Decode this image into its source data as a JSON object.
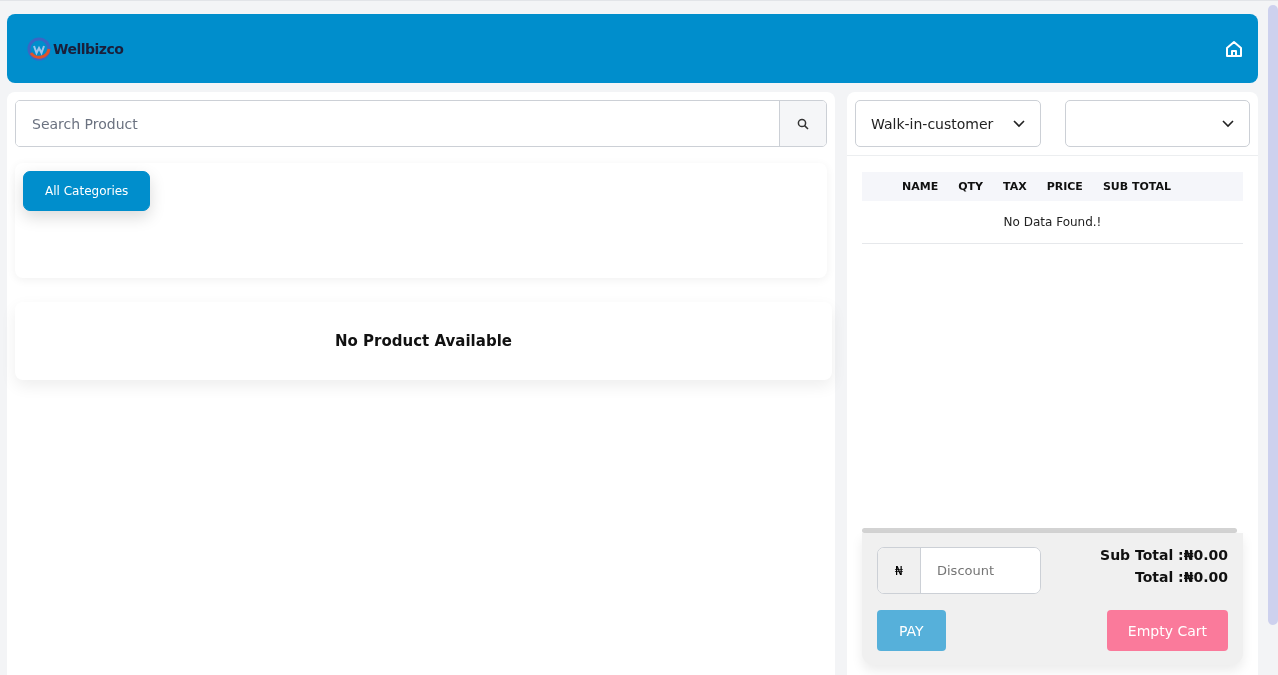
{
  "header": {
    "logo_text": "Wellbizco"
  },
  "search": {
    "placeholder": "Search Product"
  },
  "categories": [
    {
      "label": "All Categories",
      "selected": true
    }
  ],
  "products": {
    "empty_message": "No Product Available"
  },
  "cart": {
    "customer_select": {
      "value": "Walk-in-customer"
    },
    "columns": [
      "NAME",
      "QTY",
      "TAX",
      "PRICE",
      "SUB TOTAL"
    ],
    "empty_message": "No Data Found.!",
    "discount": {
      "currency": "₦",
      "placeholder": "Discount"
    },
    "sub_total": "Sub Total :₦0.00",
    "total": "Total :₦0.00",
    "buttons": [
      {
        "label": "PAY",
        "kind": "pay"
      },
      {
        "label": "Empty Cart",
        "kind": "empty"
      }
    ]
  }
}
